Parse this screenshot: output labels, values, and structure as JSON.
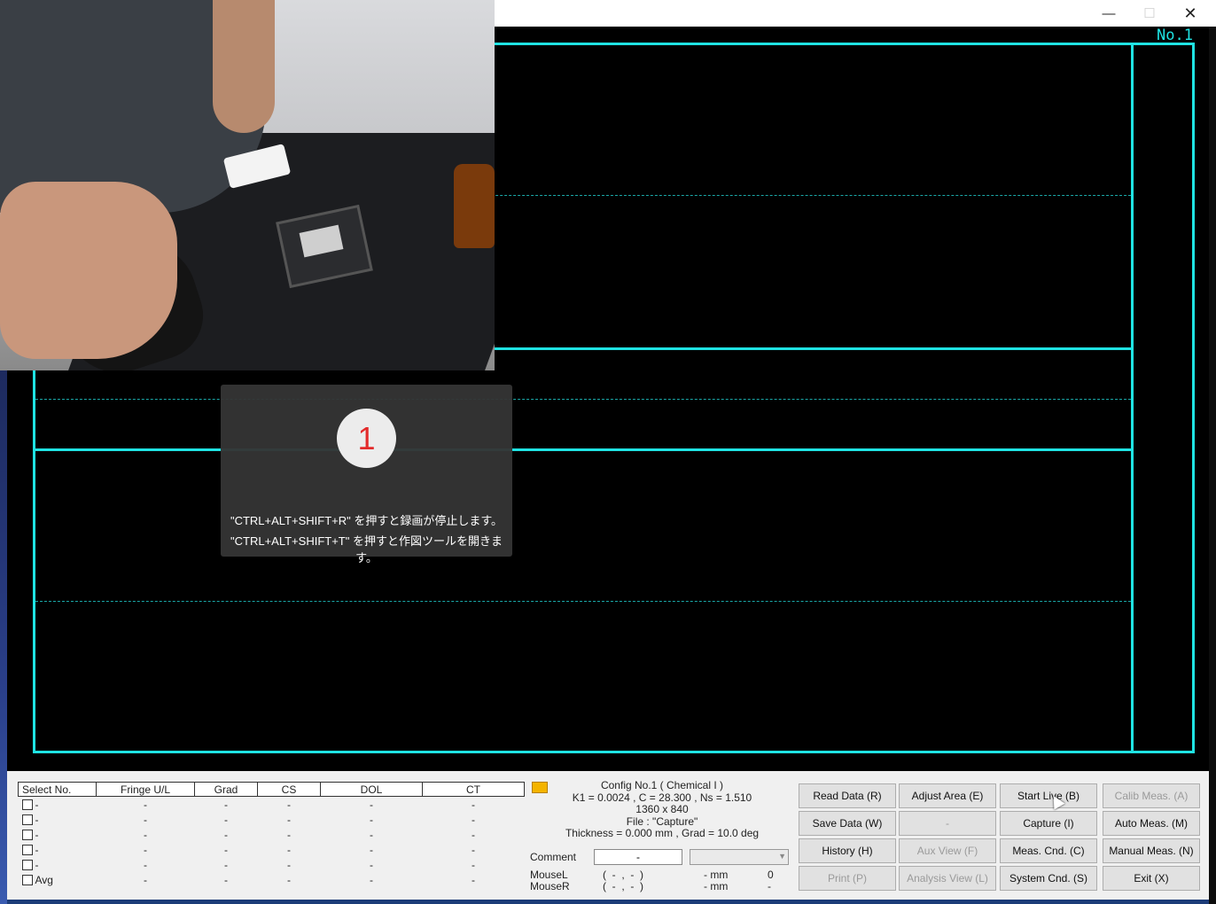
{
  "window": {
    "min_label": "—",
    "max_label": "☐",
    "close_label": "✕",
    "config_label": "No.1",
    "accent_color": "#1fe3e3"
  },
  "recorder_popup": {
    "number": "1",
    "line1": "\"CTRL+ALT+SHIFT+R\" を押すと録画が停止します。",
    "line2": "\"CTRL+ALT+SHIFT+T\" を押すと作図ツールを開きます。"
  },
  "results_table": {
    "headers": [
      "Select No.",
      "Fringe U/L",
      "Grad",
      "CS",
      "DOL",
      "CT"
    ],
    "rows": [
      [
        "-",
        "-",
        "-",
        "-",
        "-",
        "-"
      ],
      [
        "-",
        "-",
        "-",
        "-",
        "-",
        "-"
      ],
      [
        "-",
        "-",
        "-",
        "-",
        "-",
        "-"
      ],
      [
        "-",
        "-",
        "-",
        "-",
        "-",
        "-"
      ],
      [
        "-",
        "-",
        "-",
        "-",
        "-",
        "-"
      ],
      [
        "Avg",
        "-",
        "-",
        "-",
        "-",
        "-"
      ]
    ]
  },
  "info": {
    "indicator_color": "#f4b400",
    "config": "Config No.1 ( Chemical I )",
    "params": "K1 = 0.0024 , C = 28.300 , Ns = 1.510",
    "resolution": "1360 x 840",
    "file": "File : \"Capture\"",
    "thickness": "Thickness = 0.000 mm , Grad = 10.0 deg",
    "comment_label": "Comment",
    "comment_value": "-",
    "mouse_l_label": "MouseL",
    "mouse_r_label": "MouseR",
    "mouse_l_coords": "(  -  ,  -  )",
    "mouse_r_coords": "(  -  ,  -  )",
    "mouse_l_value": "- mm",
    "mouse_r_value": "- mm",
    "mouse_l_extra": "0",
    "mouse_r_extra": "-"
  },
  "buttons": {
    "read_data": "Read Data (R)",
    "adjust_area": "Adjust Area (E)",
    "start_live": "Start Live (B)",
    "calib_meas": "Calib Meas. (A)",
    "save_data": "Save Data (W)",
    "blank": "-",
    "capture": "Capture (I)",
    "auto_meas": "Auto Meas. (M)",
    "history": "History (H)",
    "aux_view": "Aux View (F)",
    "meas_cnd": "Meas. Cnd. (C)",
    "manual_meas": "Manual Meas. (N)",
    "print": "Print (P)",
    "analysis_view": "Analysis View (L)",
    "system_cnd": "System Cnd. (S)",
    "exit": "Exit (X)"
  }
}
